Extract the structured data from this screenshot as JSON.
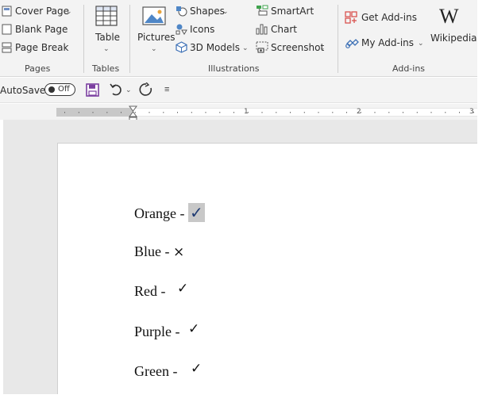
{
  "ribbon": {
    "pages": {
      "group_label": "Pages",
      "cover_page": "Cover Page",
      "blank_page": "Blank Page",
      "page_break": "Page Break"
    },
    "tables": {
      "group_label": "Tables",
      "table": "Table"
    },
    "illustrations": {
      "group_label": "Illustrations",
      "pictures": "Pictures",
      "shapes": "Shapes",
      "icons": "Icons",
      "models_3d": "3D Models",
      "smartart": "SmartArt",
      "chart": "Chart",
      "screenshot": "Screenshot"
    },
    "addins": {
      "group_label": "Add-ins",
      "get_addins": "Get Add-ins",
      "my_addins": "My Add-ins",
      "wikipedia": "Wikipedia",
      "wikipedia_glyph": "W"
    }
  },
  "qat": {
    "autosave_label": "AutoSave",
    "autosave_state": "Off"
  },
  "ruler": {
    "marks": [
      "1",
      "2",
      "3"
    ]
  },
  "document": {
    "lines": [
      {
        "text": "Orange - ",
        "mark": "✓",
        "selected": true
      },
      {
        "text": "Blue - ",
        "mark": "×",
        "selected": false
      },
      {
        "text": "Red - ",
        "mark": "✓",
        "selected": false
      },
      {
        "text": "Purple - ",
        "mark": "✓",
        "selected": false
      },
      {
        "text": "Green - ",
        "mark": "✓",
        "selected": false
      }
    ]
  },
  "colors": {
    "ribbon_bg": "#f3f3f3",
    "accent_blue": "#2b6cb0",
    "save_purple": "#7b3fa0",
    "selection_gray": "#c8c8c8",
    "checkmark_blue": "#1f3b73"
  },
  "icons": [
    "cover-page-icon",
    "blank-page-icon",
    "page-break-icon",
    "table-icon",
    "pictures-icon",
    "shapes-icon",
    "icons-icon",
    "3d-models-icon",
    "smartart-icon",
    "chart-icon",
    "screenshot-icon",
    "get-addins-icon",
    "my-addins-icon",
    "wikipedia-icon",
    "save-icon",
    "undo-icon",
    "redo-icon",
    "customize-qat-icon"
  ]
}
